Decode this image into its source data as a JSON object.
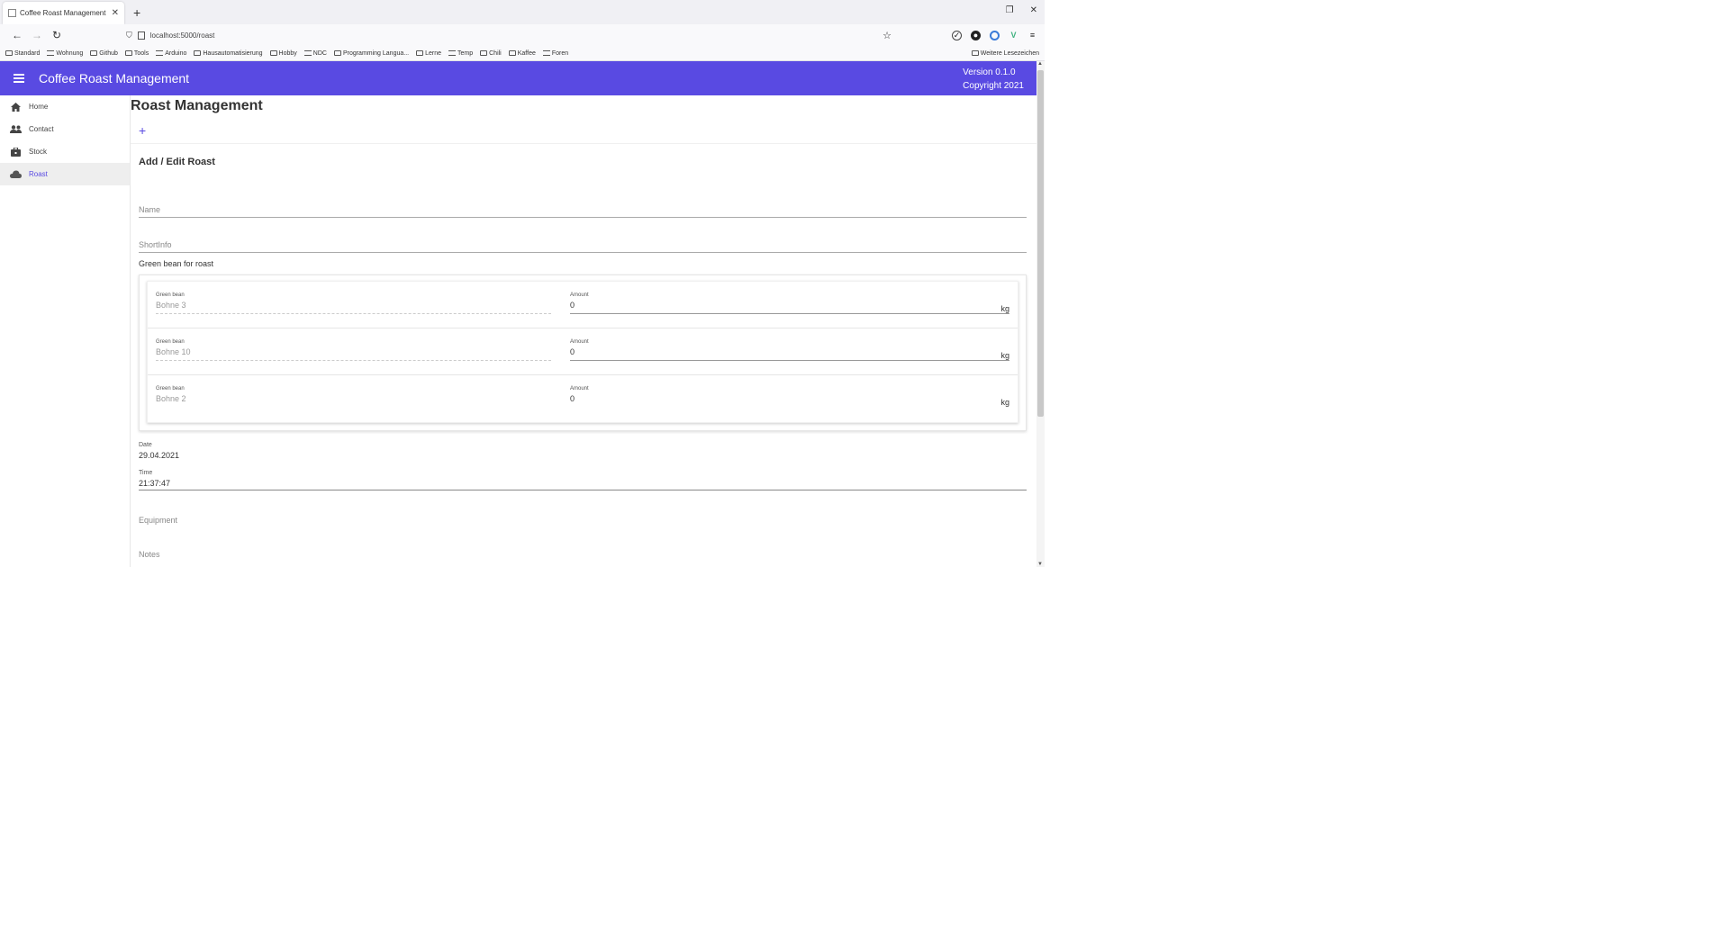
{
  "browser": {
    "tab_title": "Coffee Roast Management",
    "tab_close": "✕",
    "new_tab": "+",
    "url": "localhost:5000/roast",
    "win_restore": "❐",
    "win_close": "✕",
    "bookmarks": [
      "Standard",
      "Wohnung",
      "Github",
      "Tools",
      "Arduino",
      "Hausautomatisierung",
      "Hobby",
      "NDC",
      "Programming Langua...",
      "Lerne",
      "Temp",
      "Chili",
      "Kaffee",
      "Foren"
    ],
    "bookmarks_other": "Weitere Lesezeichen"
  },
  "app": {
    "title": "Coffee Roast Management",
    "version": "Version 0.1.0",
    "copyright": "Copyright 2021"
  },
  "nav": [
    {
      "label": "Home",
      "icon": "home-icon"
    },
    {
      "label": "Contact",
      "icon": "people-icon"
    },
    {
      "label": "Stock",
      "icon": "briefcase-icon"
    },
    {
      "label": "Roast",
      "icon": "cloud-icon",
      "active": true
    }
  ],
  "page": {
    "title": "Roast Management",
    "add": "+",
    "form_title": "Add / Edit Roast",
    "name_label": "Name",
    "shortinfo_label": "ShortInfo",
    "green_bean_section": "Green bean for roast",
    "bean_label": "Green bean",
    "amount_label": "Amount",
    "unit": "kg",
    "beans": [
      {
        "bean": "Bohne 3",
        "amount": "0"
      },
      {
        "bean": "Bohne 10",
        "amount": "0"
      },
      {
        "bean": "Bohne 2",
        "amount": "0"
      }
    ],
    "date_label": "Date",
    "date_value": "29.04.2021",
    "time_label": "Time",
    "time_value": "21:37:47",
    "equipment_label": "Equipment",
    "notes_label": "Notes"
  }
}
